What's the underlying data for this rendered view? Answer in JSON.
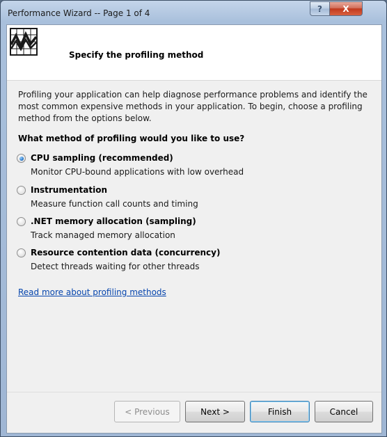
{
  "window": {
    "title": "Performance Wizard -- Page 1 of 4",
    "help_label": "?",
    "close_label": "X"
  },
  "header": {
    "title": "Specify the profiling method",
    "icon": "performance-chart-icon"
  },
  "intro_text": "Profiling your application can help diagnose performance problems and identify the most common expensive methods in your application. To begin, choose a profiling method from the options below.",
  "question": "What method of profiling would you like to use?",
  "options": [
    {
      "label": "CPU sampling (recommended)",
      "description": "Monitor CPU-bound applications with low overhead",
      "selected": true
    },
    {
      "label": "Instrumentation",
      "description": "Measure function call counts and timing",
      "selected": false
    },
    {
      "label": ".NET memory allocation (sampling)",
      "description": "Track managed memory allocation",
      "selected": false
    },
    {
      "label": "Resource contention data (concurrency)",
      "description": "Detect threads waiting for other threads",
      "selected": false
    }
  ],
  "link_text": "Read more about profiling methods",
  "buttons": {
    "previous": "< Previous",
    "next": "Next >",
    "finish": "Finish",
    "cancel": "Cancel"
  },
  "colors": {
    "link": "#0645ad",
    "selection": "#1f6fc2"
  }
}
